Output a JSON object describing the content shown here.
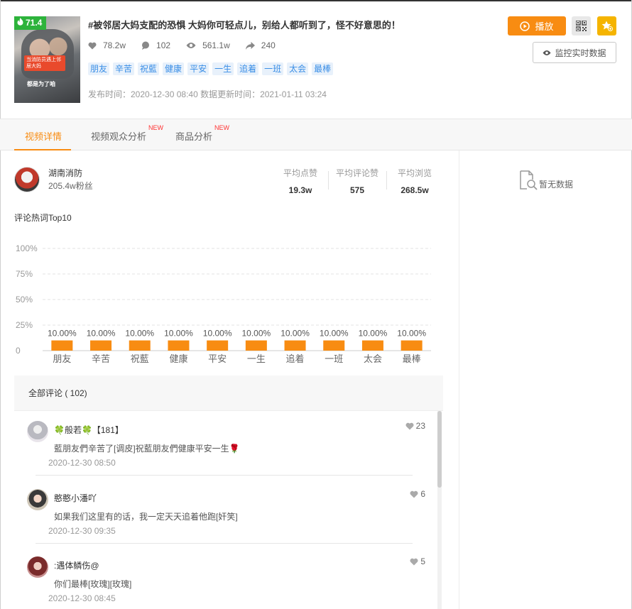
{
  "video": {
    "score": "71.4",
    "thumb_caption": "当消防员遇上邻居大妈",
    "thumb_caption2": "都是为了咱",
    "title": "#被邻居大妈支配的恐惧 大妈你可轻点儿，别给人都听到了，怪不好意思的！",
    "likes": "78.2w",
    "comments": "102",
    "views": "561.1w",
    "shares": "240",
    "tags": [
      "朋友",
      "辛苦",
      "祝藍",
      "健康",
      "平安",
      "一生",
      "追着",
      "一班",
      "太会",
      "最棒"
    ],
    "dates": "发布时间：2020-12-30 08:40 数据更新时间：2021-01-11 03:24"
  },
  "actions": {
    "play_label": "播放",
    "monitor_label": "监控实时数据"
  },
  "tabs": [
    {
      "label": "视频详情",
      "new": ""
    },
    {
      "label": "视频观众分析",
      "new": "NEW"
    },
    {
      "label": "商品分析",
      "new": "NEW"
    }
  ],
  "author": {
    "name": "湖南消防",
    "fans": "205.4w粉丝"
  },
  "metrics": [
    {
      "label": "平均点赞",
      "value": "19.3w"
    },
    {
      "label": "平均评论赞",
      "value": "575"
    },
    {
      "label": "平均浏览",
      "value": "268.5w"
    }
  ],
  "side": {
    "empty_text": "暂无数据"
  },
  "chart_section_title": "评论热词Top10",
  "chart_data": {
    "type": "bar",
    "categories": [
      "朋友",
      "辛苦",
      "祝藍",
      "健康",
      "平安",
      "一生",
      "追着",
      "一班",
      "太会",
      "最棒"
    ],
    "values": [
      10,
      10,
      10,
      10,
      10,
      10,
      10,
      10,
      10,
      10
    ],
    "data_labels": [
      "10.00%",
      "10.00%",
      "10.00%",
      "10.00%",
      "10.00%",
      "10.00%",
      "10.00%",
      "10.00%",
      "10.00%",
      "10.00%"
    ],
    "yticks": [
      "0",
      "25%",
      "50%",
      "75%",
      "100%"
    ],
    "ylim": [
      0,
      100
    ],
    "color": "#f88c12",
    "grid": true
  },
  "comments_panel": {
    "header": "全部评论 ( 102)",
    "items": [
      {
        "name": "🍀般若🍀【181】",
        "likes": "23",
        "text": "藍朋友們辛苦了[调皮]祝藍朋友們健康平安一生🌹",
        "time": "2020-12-30 08:50"
      },
      {
        "name": "憨憨小潘吖",
        "likes": "6",
        "text": "如果我们这里有的话，我一定天天追着他跑[奸笑]",
        "time": "2020-12-30 09:35"
      },
      {
        "name": ":遇体鳞伤@",
        "likes": "5",
        "text": "你们最棒[玫瑰][玫瑰]",
        "time": "2020-12-30 08:45"
      }
    ]
  }
}
